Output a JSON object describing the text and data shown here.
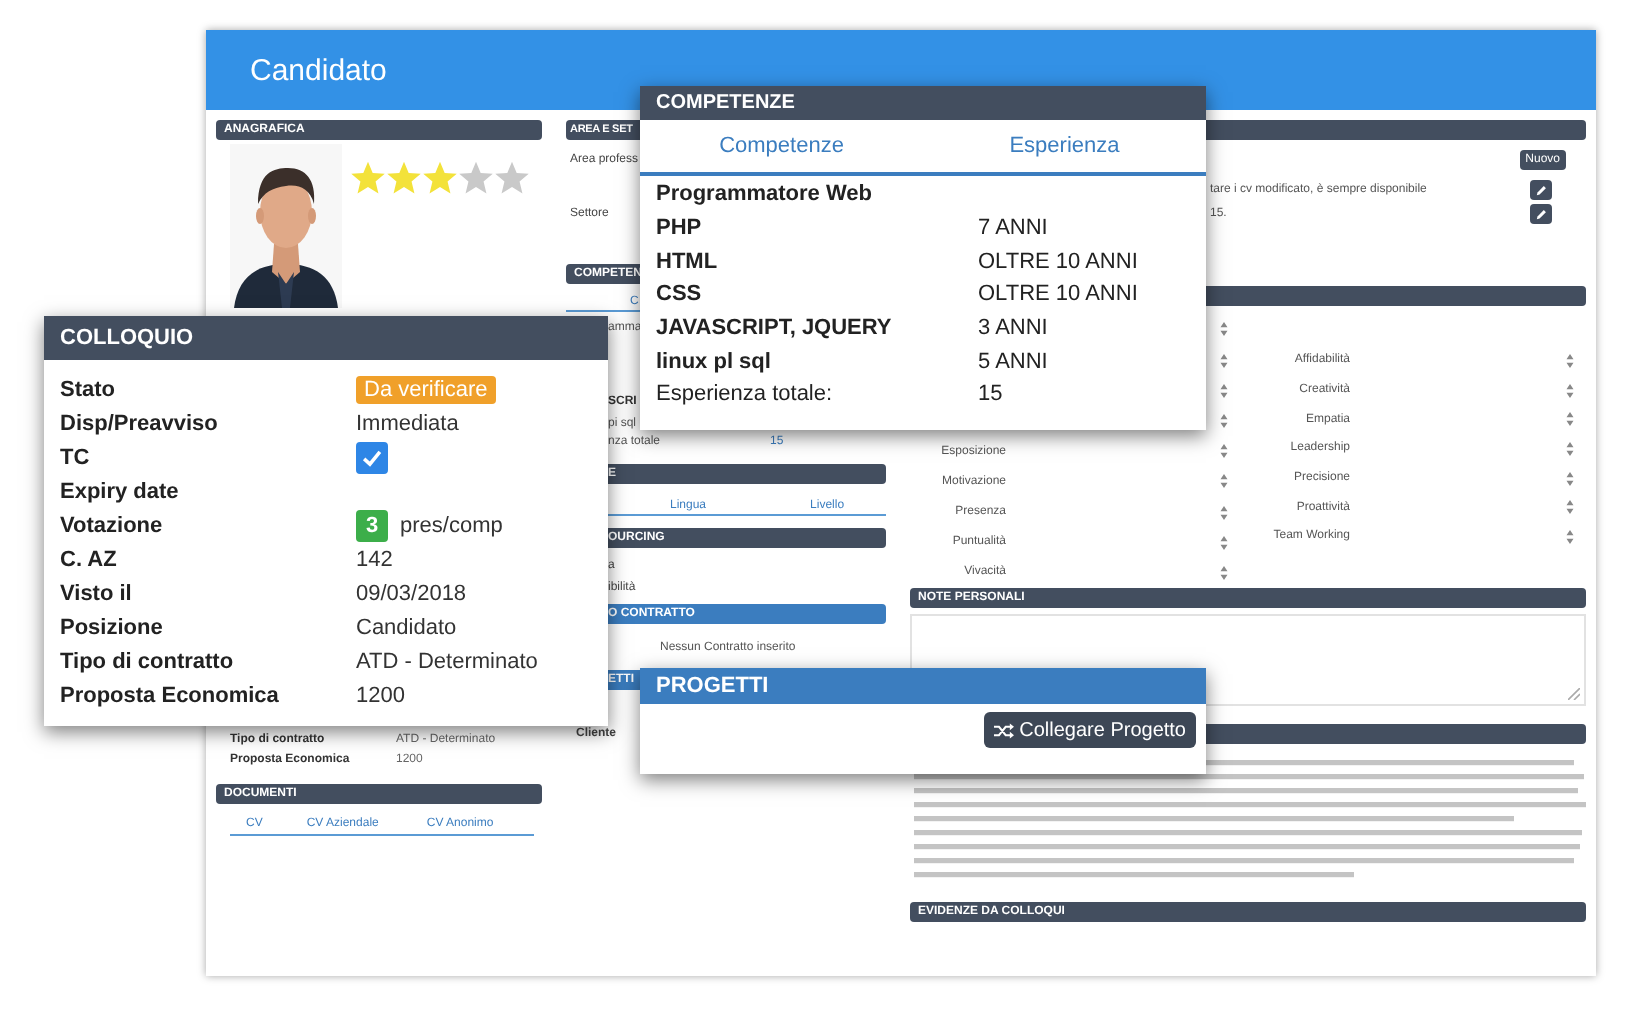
{
  "window": {
    "title": "Candidato"
  },
  "anagrafica": {
    "title": "ANAGRAFICA",
    "stars": 3,
    "rows": [
      {
        "label": "Tipo di contratto",
        "value": "ATD - Determinato"
      },
      {
        "label": "Proposta Economica",
        "value": "1200"
      }
    ]
  },
  "documenti": {
    "title": "DOCUMENTI",
    "columns": [
      "CV",
      "CV Aziendale",
      "CV Anonimo"
    ]
  },
  "area_settore": {
    "title": "AREA E SET",
    "rows": [
      {
        "label": "Area profess",
        "action": "Nuovo"
      },
      {
        "text": "tare i cv modificato, è sempre disponibile",
        "editable": true
      },
      {
        "label": "Settore",
        "text": "15.",
        "editable": true
      }
    ]
  },
  "competenze_panel": {
    "title": "COMPETEN",
    "columns": [
      "C"
    ],
    "lines": [
      {
        "kind": "text",
        "text": "amma"
      },
      {
        "kind": "heading",
        "text": "SCRI"
      },
      {
        "kind": "text",
        "text": "pi sql"
      },
      {
        "kind": "text",
        "text": "nza totale",
        "value": "15"
      }
    ]
  },
  "lingue": {
    "title": "E",
    "columns": [
      "Lingua",
      "Livello"
    ]
  },
  "sourcing": {
    "title": "OURCING",
    "lines": [
      "a",
      "ibilità"
    ]
  },
  "contratto": {
    "title": "O CONTRATTO",
    "empty": "Nessun Contratto inserito"
  },
  "progetti_panel": {
    "title": "ETTI",
    "lines": [
      "Cliente"
    ]
  },
  "valutazione": {
    "left": [
      {
        "kind": "unlabeled"
      },
      {
        "kind": "unlabeled"
      },
      {
        "kind": "unlabeled"
      },
      {
        "kind": "unlabeled"
      },
      {
        "kind": "labeled",
        "label": "Esposizione"
      },
      {
        "kind": "labeled",
        "label": "Motivazione"
      },
      {
        "kind": "labeled",
        "label": "Presenza"
      },
      {
        "kind": "labeled",
        "label": "Puntualità"
      },
      {
        "kind": "labeled",
        "label": "Vivacità"
      }
    ],
    "right": [
      {
        "kind": "labeled",
        "label": "Affidabilità"
      },
      {
        "kind": "labeled",
        "label": "Creatività"
      },
      {
        "kind": "labeled",
        "label": "Empatia"
      },
      {
        "kind": "labeled",
        "label": "Leadership"
      },
      {
        "kind": "labeled",
        "label": "Precisione"
      },
      {
        "kind": "labeled",
        "label": "Proattività"
      },
      {
        "kind": "labeled",
        "label": "Team Working"
      }
    ]
  },
  "note_personali": {
    "title": "NOTE PERSONALI"
  },
  "descrizione": {
    "kind": "illegible-text"
  },
  "evidenze": {
    "title": "EVIDENZE DA COLLOQUI"
  },
  "colloquio": {
    "title": "COLLOQUIO",
    "rows": [
      {
        "label": "Stato",
        "kind": "badge",
        "value": "Da verificare"
      },
      {
        "label": "Disp/Preavviso",
        "kind": "text",
        "value": "Immediata"
      },
      {
        "label": "TC",
        "kind": "checkbox",
        "checked": true
      },
      {
        "label": "Expiry date",
        "kind": "text"
      },
      {
        "label": "Votazione",
        "kind": "score",
        "score": "3",
        "value": "pres/comp"
      },
      {
        "label": "C. AZ",
        "kind": "text",
        "value": "142"
      },
      {
        "label": "Visto il",
        "kind": "text",
        "value": "09/03/2018"
      },
      {
        "label": "Posizione",
        "kind": "text",
        "value": "Candidato"
      },
      {
        "label": "Tipo di contratto",
        "kind": "text",
        "value": "ATD - Determinato"
      },
      {
        "label": "Proposta Economica",
        "kind": "text",
        "value": "1200"
      }
    ]
  },
  "competenze": {
    "title": "COMPETENZE",
    "columns": [
      "Competenze",
      "Esperienza"
    ],
    "rows": [
      {
        "kind": "group",
        "skill": "Programmatore Web"
      },
      {
        "kind": "skill",
        "skill": "PHP",
        "experience": "7 ANNI"
      },
      {
        "kind": "skill",
        "skill": "HTML",
        "experience": "OLTRE 10 ANNI"
      },
      {
        "kind": "skill",
        "skill": "CSS",
        "experience": "OLTRE 10 ANNI"
      },
      {
        "kind": "skill",
        "skill": "JAVASCRIPT, JQUERY",
        "experience": "3 ANNI"
      },
      {
        "kind": "skill",
        "skill": "linux pl sql",
        "experience": "5 ANNI"
      },
      {
        "kind": "total",
        "skill": "Esperienza totale:",
        "experience": "15"
      }
    ]
  },
  "progetti": {
    "title": "PROGETTI",
    "button": "Collegare Progetto"
  }
}
